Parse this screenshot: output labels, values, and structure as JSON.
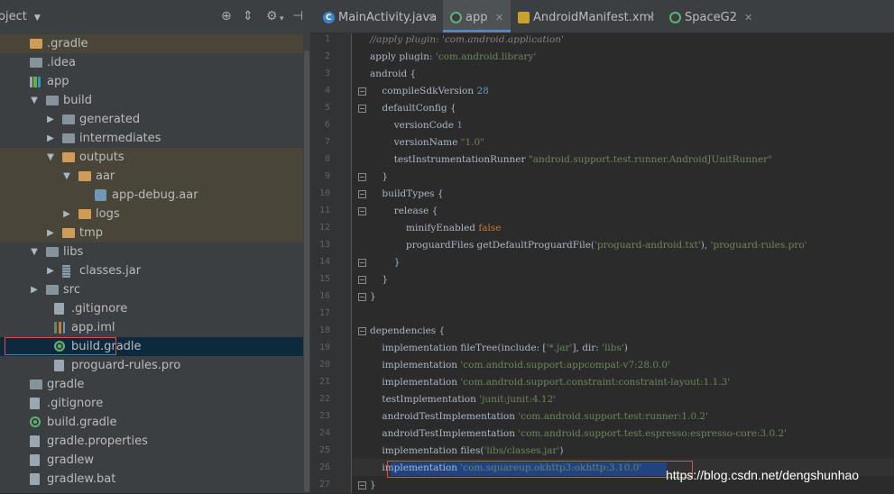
{
  "project_panel": {
    "title": "oject",
    "tree": [
      {
        "label": ".gradle",
        "icon": "folder-orange-icon",
        "kind": "folder-o",
        "arrow": "",
        "depth": 0,
        "highlight": "brown"
      },
      {
        "label": ".idea",
        "icon": "folder-icon",
        "kind": "folder",
        "arrow": "",
        "depth": 0,
        "highlight": ""
      },
      {
        "label": "app",
        "icon": "app-module-icon",
        "kind": "app",
        "arrow": "",
        "depth": 0,
        "highlight": ""
      },
      {
        "label": "build",
        "icon": "folder-icon",
        "kind": "folder",
        "arrow": "▼",
        "depth": 1,
        "highlight": ""
      },
      {
        "label": "generated",
        "icon": "folder-icon",
        "kind": "folder",
        "arrow": "▶",
        "depth": 2,
        "highlight": ""
      },
      {
        "label": "intermediates",
        "icon": "folder-icon",
        "kind": "folder",
        "arrow": "▶",
        "depth": 2,
        "highlight": ""
      },
      {
        "label": "outputs",
        "icon": "folder-orange-icon",
        "kind": "folder-o",
        "arrow": "▼",
        "depth": 2,
        "highlight": "brown"
      },
      {
        "label": "aar",
        "icon": "folder-orange-icon",
        "kind": "folder-o",
        "arrow": "▼",
        "depth": 3,
        "highlight": "brown"
      },
      {
        "label": "app-debug.aar",
        "icon": "aar-file-icon",
        "kind": "aar",
        "arrow": "",
        "depth": 4,
        "highlight": "brown"
      },
      {
        "label": "logs",
        "icon": "folder-orange-icon",
        "kind": "folder-o",
        "arrow": "▶",
        "depth": 3,
        "highlight": "brown"
      },
      {
        "label": "tmp",
        "icon": "folder-orange-icon",
        "kind": "folder-o",
        "arrow": "▶",
        "depth": 2,
        "highlight": "brown"
      },
      {
        "label": "libs",
        "icon": "folder-icon",
        "kind": "folder",
        "arrow": "▼",
        "depth": 1,
        "highlight": ""
      },
      {
        "label": "classes.jar",
        "icon": "jar-file-icon",
        "kind": "jar",
        "arrow": "▶",
        "depth": 2,
        "highlight": ""
      },
      {
        "label": "src",
        "icon": "folder-icon",
        "kind": "folder",
        "arrow": "▶",
        "depth": 1,
        "highlight": ""
      },
      {
        "label": ".gitignore",
        "icon": "file-icon",
        "kind": "file",
        "arrow": "",
        "depth": 1.5,
        "highlight": ""
      },
      {
        "label": "app.iml",
        "icon": "iml-file-icon",
        "kind": "iml",
        "arrow": "",
        "depth": 1.5,
        "highlight": ""
      },
      {
        "label": "build.gradle",
        "icon": "gradle-icon",
        "kind": "gradle",
        "arrow": "",
        "depth": 1.5,
        "highlight": "selected"
      },
      {
        "label": "proguard-rules.pro",
        "icon": "file-icon",
        "kind": "file",
        "arrow": "",
        "depth": 1.5,
        "highlight": ""
      },
      {
        "label": "gradle",
        "icon": "folder-icon",
        "kind": "folder",
        "arrow": "",
        "depth": 0,
        "highlight": ""
      },
      {
        "label": ".gitignore",
        "icon": "file-icon",
        "kind": "file",
        "arrow": "",
        "depth": 0,
        "highlight": ""
      },
      {
        "label": "build.gradle",
        "icon": "gradle-icon",
        "kind": "gradle",
        "arrow": "",
        "depth": 0,
        "highlight": ""
      },
      {
        "label": "gradle.properties",
        "icon": "file-icon",
        "kind": "file",
        "arrow": "",
        "depth": 0,
        "highlight": ""
      },
      {
        "label": "gradlew",
        "icon": "file-icon",
        "kind": "file",
        "arrow": "",
        "depth": 0,
        "highlight": ""
      },
      {
        "label": "gradlew.bat",
        "icon": "file-icon",
        "kind": "file",
        "arrow": "",
        "depth": 0,
        "highlight": ""
      }
    ]
  },
  "tabs": [
    {
      "label": "MainActivity.java",
      "icon": "java-class-icon",
      "active": false
    },
    {
      "label": "app",
      "icon": "gradle-icon",
      "active": true
    },
    {
      "label": "AndroidManifest.xml",
      "icon": "manifest-icon",
      "active": false
    },
    {
      "label": "SpaceG2",
      "icon": "gradle-icon",
      "active": false
    }
  ],
  "editor": {
    "lines": [
      [
        {
          "t": "//apply plugin: 'com.android.application'",
          "c": "com"
        }
      ],
      [
        {
          "t": "apply plugin: ",
          "c": ""
        },
        {
          "t": "'com.android.library'",
          "c": "str"
        }
      ],
      [
        {
          "t": "android {",
          "c": ""
        }
      ],
      [
        {
          "t": "    compileSdkVersion ",
          "c": ""
        },
        {
          "t": "28",
          "c": "num"
        }
      ],
      [
        {
          "t": "    defaultConfig {",
          "c": ""
        }
      ],
      [
        {
          "t": "        versionCode ",
          "c": ""
        },
        {
          "t": "1",
          "c": "num"
        }
      ],
      [
        {
          "t": "        versionName ",
          "c": ""
        },
        {
          "t": "\"1.0\"",
          "c": "str"
        }
      ],
      [
        {
          "t": "        testInstrumentationRunner ",
          "c": ""
        },
        {
          "t": "\"android.support.test.runner.AndroidJUnitRunner\"",
          "c": "str"
        }
      ],
      [
        {
          "t": "    }",
          "c": ""
        }
      ],
      [
        {
          "t": "    buildTypes {",
          "c": ""
        }
      ],
      [
        {
          "t": "        release {",
          "c": ""
        }
      ],
      [
        {
          "t": "            minifyEnabled ",
          "c": ""
        },
        {
          "t": "false",
          "c": "kw"
        }
      ],
      [
        {
          "t": "            proguardFiles getDefaultProguardFile(",
          "c": ""
        },
        {
          "t": "'proguard-android.txt'",
          "c": "str"
        },
        {
          "t": "), ",
          "c": ""
        },
        {
          "t": "'proguard-rules.pro'",
          "c": "str"
        }
      ],
      [
        {
          "t": "        }",
          "c": ""
        }
      ],
      [
        {
          "t": "    }",
          "c": ""
        }
      ],
      [
        {
          "t": "}",
          "c": ""
        }
      ],
      [
        {
          "t": "",
          "c": ""
        }
      ],
      [
        {
          "t": "dependencies {",
          "c": ""
        }
      ],
      [
        {
          "t": "    implementation fileTree(include: [",
          "c": ""
        },
        {
          "t": "'*.jar'",
          "c": "str"
        },
        {
          "t": "], dir: ",
          "c": ""
        },
        {
          "t": "'libs'",
          "c": "str"
        },
        {
          "t": ")",
          "c": ""
        }
      ],
      [
        {
          "t": "    implementation ",
          "c": ""
        },
        {
          "t": "'com.android.support:appcompat-v7:28.0.0'",
          "c": "str"
        }
      ],
      [
        {
          "t": "    implementation ",
          "c": ""
        },
        {
          "t": "'com.android.support.constraint:constraint-layout:1.1.3'",
          "c": "str"
        }
      ],
      [
        {
          "t": "    testImplementation ",
          "c": ""
        },
        {
          "t": "'junit:junit:4.12'",
          "c": "str"
        }
      ],
      [
        {
          "t": "    androidTestImplementation ",
          "c": ""
        },
        {
          "t": "'com.android.support.test:runner:1.0.2'",
          "c": "str"
        }
      ],
      [
        {
          "t": "    androidTestImplementation ",
          "c": ""
        },
        {
          "t": "'com.android.support.test.espresso:espresso-core:3.0.2'",
          "c": "str"
        }
      ],
      [
        {
          "t": "    implementation files(",
          "c": ""
        },
        {
          "t": "'libs/classes.jar'",
          "c": "str"
        },
        {
          "t": ")",
          "c": ""
        }
      ],
      [
        {
          "t": "    implementation ",
          "c": ""
        },
        {
          "t": "'com.squareup.okhttp3:okhttp:3.10.0'",
          "c": "str"
        }
      ],
      [
        {
          "t": "}",
          "c": ""
        }
      ]
    ],
    "fold_lines": [
      4,
      5,
      9,
      10,
      11,
      14,
      15,
      16,
      18,
      27
    ]
  },
  "watermark": "https://blog.csdn.net/dengshunhao",
  "colors": {
    "accent": "#4a88c7",
    "highlight_box": "#e04b4b",
    "string": "#6a8759",
    "number": "#6897bb",
    "keyword": "#cc7832"
  }
}
